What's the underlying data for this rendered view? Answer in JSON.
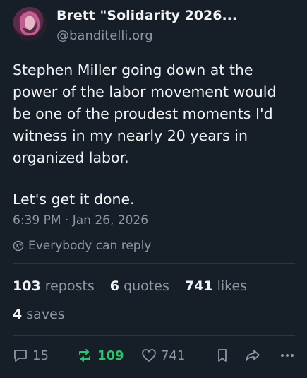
{
  "author": {
    "name": "Brett \"Solidarity 2026...",
    "handle": "@banditelli.org"
  },
  "post": {
    "paragraph_1": "Stephen Miller going down at the power of the labor movement would be one of the proudest moments I'd witness in my nearly 20 years in organized labor.",
    "paragraph_2": "Let's get it done.",
    "timestamp": "6:39 PM · Jan 26, 2026",
    "reply_setting": "Everybody can reply"
  },
  "stats": {
    "reposts_count": "103",
    "reposts_label": "reposts",
    "quotes_count": "6",
    "quotes_label": "quotes",
    "likes_count": "741",
    "likes_label": "likes",
    "saves_count": "4",
    "saves_label": "saves"
  },
  "actions": {
    "reply_count": "15",
    "repost_count": "109",
    "like_count": "741"
  },
  "colors": {
    "background": "#161e27",
    "text": "#f1f3f5",
    "muted": "#8b98a5",
    "repost_active": "#2ec26d"
  }
}
